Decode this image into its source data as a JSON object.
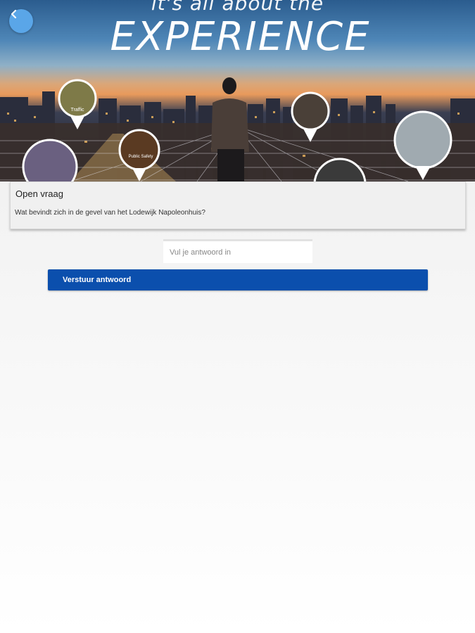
{
  "hero": {
    "tagline_small": "it's all about the",
    "tagline_large": "EXPERIENCE",
    "pin_labels": [
      "Traffic",
      "Public Safety"
    ]
  },
  "nav": {
    "back_icon": "chevron-left-icon"
  },
  "question_card": {
    "title": "Open vraag",
    "question": "Wat bevindt zich in de gevel van het Lodewijk Napoleonhuis?"
  },
  "answer": {
    "placeholder": "Vul je antwoord in",
    "value": ""
  },
  "submit": {
    "label": "Verstuur antwoord"
  },
  "colors": {
    "accent": "#0b4fad",
    "back_button": "#5aa6e8",
    "card_bg": "#f0f0f0"
  }
}
